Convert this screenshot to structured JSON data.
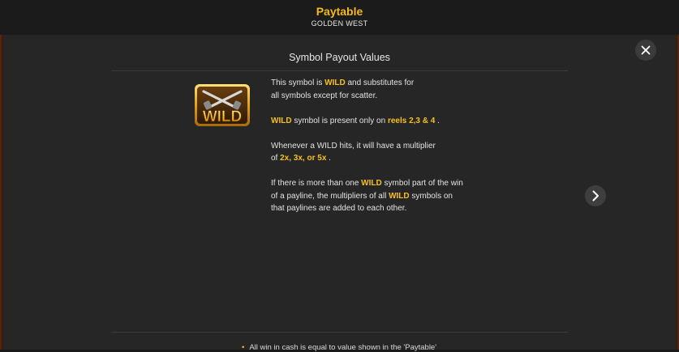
{
  "header": {
    "title": "Paytable",
    "subtitle": "GOLDEN WEST"
  },
  "section": {
    "title": "Symbol Payout Values"
  },
  "symbol": {
    "label": "WILD",
    "icon": "wild-crossed-pistols-icon",
    "colors": {
      "gold": "#f5b820",
      "dark": "#3a2a10"
    }
  },
  "description": {
    "p1_a": "This symbol is ",
    "p1_wild": "WILD",
    "p1_b": " and substitutes for",
    "p1_c": "all symbols except for scatter.",
    "p2_wild": "WILD",
    "p2_a": " symbol is present only on ",
    "p2_reels": "reels 2,3 & 4",
    "p2_b": " .",
    "p3_a": "Whenever a WILD hits, it will have a multiplier",
    "p3_b": "of ",
    "p3_mult": "2x, 3x, or 5x",
    "p3_c": " .",
    "p4_a": "If there is more than one ",
    "p4_wild1": "WILD",
    "p4_b": " symbol part of the win",
    "p4_c": "of a payline, the multipliers of all ",
    "p4_wild2": "WILD",
    "p4_d": " symbols on",
    "p4_e": "that paylines are added to each other."
  },
  "footnote": {
    "text": "All win in cash is equal to value shown in the 'Paytable'"
  },
  "buttons": {
    "close_icon": "close-icon",
    "next_icon": "chevron-right-icon"
  },
  "colors": {
    "accent": "#f5c020",
    "background": "#262626",
    "header_bg": "#1b1b1b"
  }
}
